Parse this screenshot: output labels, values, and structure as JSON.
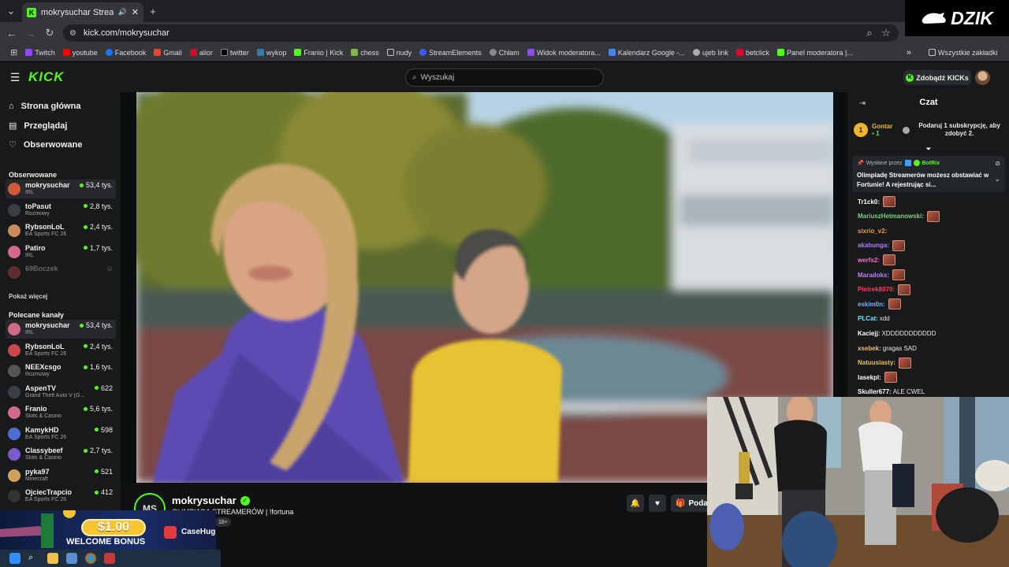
{
  "browser": {
    "tab_title": "mokrysuchar Stream - Watch",
    "url": "kick.com/mokrysuchar",
    "bookmarks": [
      "Twitch",
      "youtube",
      "Facebook",
      "Gmail",
      "alior",
      "twitter",
      "wykop",
      "Franio | Kick",
      "chess",
      "nudy",
      "StreamElements",
      "Chłam",
      "Widok moderatora...",
      "Kalendarz Google -...",
      "ujeb link",
      "betclick",
      "Panel moderatora |..."
    ],
    "all_bookmarks": "Wszystkie zakładki"
  },
  "header": {
    "logo": "KICK",
    "search_placeholder": "Wyszukaj",
    "get_kicks": "Zdobądź KICKs"
  },
  "sidebar": {
    "nav": [
      "Strona główna",
      "Przeglądaj",
      "Obserwowane"
    ],
    "followed_title": "Obserwowane",
    "followed": [
      {
        "name": "mokrysuchar",
        "category": "IRL",
        "viewers": "53,4 tys."
      },
      {
        "name": "toPasut",
        "category": "Rozmowy",
        "viewers": "2,8 tys."
      },
      {
        "name": "RybsonLoL",
        "category": "EA Sports FC 26",
        "viewers": "2,4 tys."
      },
      {
        "name": "Patiro",
        "category": "IRL",
        "viewers": "1,7 tys."
      },
      {
        "name": "69Boczek",
        "category": "",
        "viewers": ""
      }
    ],
    "show_more": "Pokaż więcej",
    "recommended_title": "Polecane kanały",
    "recommended": [
      {
        "name": "mokrysuchar",
        "category": "IRL",
        "viewers": "53,4 tys."
      },
      {
        "name": "RybsonLoL",
        "category": "EA Sports FC 26",
        "viewers": "2,4 tys."
      },
      {
        "name": "NEEXcsgo",
        "category": "Rozmowy",
        "viewers": "1,6 tys."
      },
      {
        "name": "AspenTV",
        "category": "Grand Theft Auto V (G...",
        "viewers": "622"
      },
      {
        "name": "Franio",
        "category": "Slots & Casino",
        "viewers": "5,6 tys."
      },
      {
        "name": "KamykHD",
        "category": "EA Sports FC 26",
        "viewers": "598"
      },
      {
        "name": "Classybeef",
        "category": "Slots & Casino",
        "viewers": "2,7 tys."
      },
      {
        "name": "pyka97",
        "category": "Minecraft",
        "viewers": "521"
      },
      {
        "name": "OjciecTrapcio",
        "category": "EA Sports FC 26",
        "viewers": "412"
      }
    ]
  },
  "stream": {
    "initials": "MS",
    "streamer": "mokrysuchar",
    "title": "OLIMPIADA STREAMERÓW | !fortuna",
    "age_badge": "18+",
    "gift_label": "Podar"
  },
  "chat": {
    "title": "Czat",
    "gifter_rank": "1",
    "gifter_name": "Gontar",
    "gifter_count": "1",
    "gift_prompt": "Podaruj 1 subskrypcję, aby zdobyć 2.",
    "pinned_by_label": "Wysłane przez",
    "pinned_by": "BotRix",
    "pinned_text": "Olimpiadę Streamerów możesz obstawiać w Fortunie! A rejestrując si...",
    "messages": [
      {
        "user": "Tr1ck0:",
        "color": "#ffffff",
        "text": "",
        "emote": true
      },
      {
        "user": "MariuszHetmanowski:",
        "color": "#7fd07f",
        "text": "",
        "emote": true
      },
      {
        "user": "sixrio_v2:",
        "color": "#ff9a3c",
        "text": "",
        "emote": false
      },
      {
        "user": "akabunga:",
        "color": "#b07cff",
        "text": "",
        "emote": true
      },
      {
        "user": "werfs2:",
        "color": "#ff6ec7",
        "text": "",
        "emote": true
      },
      {
        "user": "Maradoks:",
        "color": "#c67cff",
        "text": "",
        "emote": true
      },
      {
        "user": "Pietrek8070:",
        "color": "#ff3b5c",
        "text": "",
        "emote": true
      },
      {
        "user": "eskim0n:",
        "color": "#6fb7ff",
        "text": "",
        "emote": true
      },
      {
        "user": "PLCat:",
        "color": "#6fe4ff",
        "text": "xdd",
        "emote": false
      },
      {
        "user": "Kaciejj:",
        "color": "#ffffff",
        "text": "XDDDDDDDDDDD",
        "emote": false
      },
      {
        "user": "xsebek:",
        "color": "#ffb86b",
        "text": "gragas SAD",
        "emote": false
      },
      {
        "user": "Natuusiasty:",
        "color": "#f0c060",
        "text": "",
        "emote": true
      },
      {
        "user": "lasekpl:",
        "color": "#ffffff",
        "text": "",
        "emote": true
      },
      {
        "user": "Skuller677:",
        "color": "#ffffff",
        "text": "ALE CWEL",
        "emote": false
      }
    ]
  },
  "overlay": {
    "brand": "DZIK",
    "ad_amount": "$1.00",
    "ad_caption": "WELCOME BONUS",
    "ad_brand": "CaseHug"
  },
  "colors": {
    "accent": "#53fc18",
    "bg": "#0b0e0f",
    "panel": "#18191b"
  }
}
